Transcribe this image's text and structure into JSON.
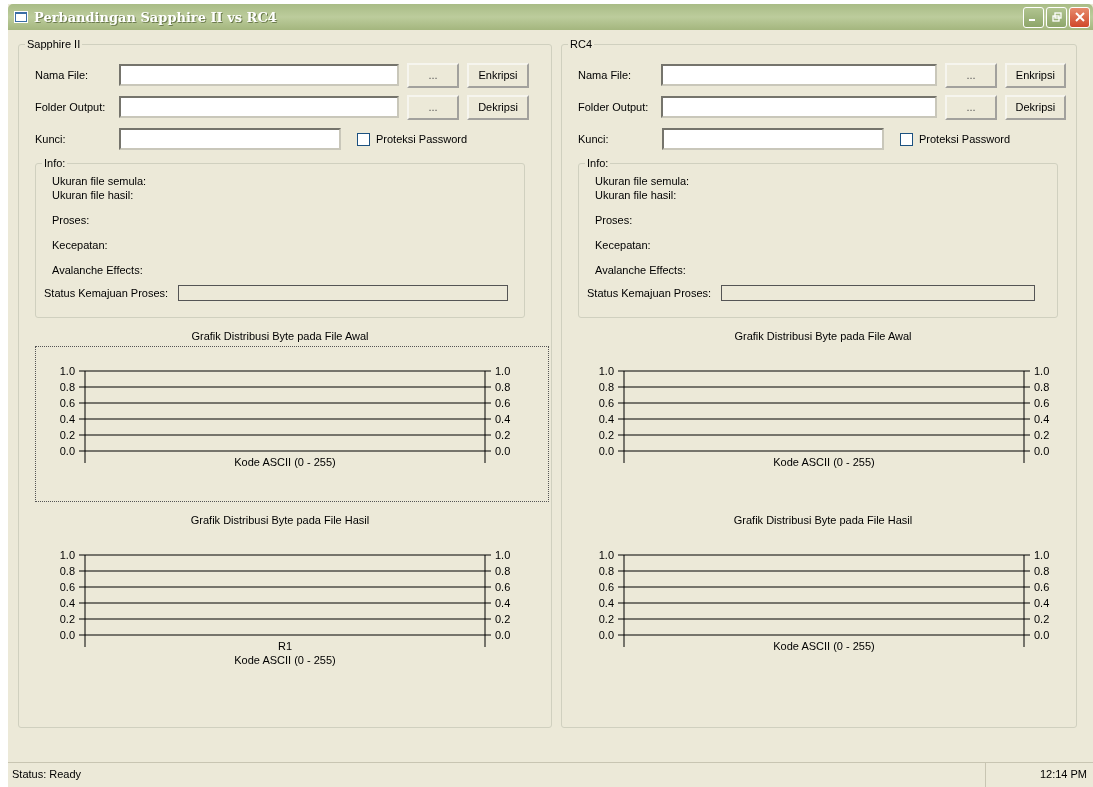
{
  "window": {
    "title": "Perbandingan Sapphire II vs RC4"
  },
  "panels": [
    {
      "title": "Sapphire II",
      "fields": [
        {
          "label": "Nama File:",
          "browse": "...",
          "action": "Enkripsi"
        },
        {
          "label": "Folder Output:",
          "browse": "...",
          "action": "Dekripsi"
        }
      ],
      "key": {
        "label": "Kunci:"
      },
      "password_protect": {
        "label": "Proteksi Password",
        "checked": false
      },
      "info": {
        "title": "Info:",
        "lines": [
          "Ukuran file semula:",
          "Ukuran file hasil:",
          "Proses:",
          "Kecepatan:",
          "Avalanche Effects:"
        ],
        "progress_label": "Status Kemajuan Proses:",
        "level": 0
      },
      "charts": [
        {
          "focused": true,
          "chart_data": {
            "type": "line",
            "grid": true,
            "title": "Grafik Distribusi Byte pada File Awal",
            "xlabel": "Kode ASCII (0 - 255)",
            "categories": [
              null
            ],
            "ylim": [
              0,
              1
            ],
            "yticks": [
              {
                "value": 0,
                "label": "0.0"
              },
              {
                "value": 0.2,
                "label": "0.2"
              },
              {
                "value": 0.4,
                "label": "0.4"
              },
              {
                "value": 0.6,
                "label": "0.6"
              },
              {
                "value": 0.8,
                "label": "0.8"
              },
              {
                "value": 1,
                "label": "1.0"
              }
            ]
          }
        },
        {
          "focused": false,
          "chart_data": {
            "type": "line",
            "grid": true,
            "title": "Grafik Distribusi Byte pada File Hasil",
            "xlabel": "Kode ASCII (0 - 255)",
            "categories": [
              "R1"
            ],
            "ylim": [
              0,
              1
            ],
            "yticks": [
              {
                "value": 0,
                "label": "0.0"
              },
              {
                "value": 0.2,
                "label": "0.2"
              },
              {
                "value": 0.4,
                "label": "0.4"
              },
              {
                "value": 0.6,
                "label": "0.6"
              },
              {
                "value": 0.8,
                "label": "0.8"
              },
              {
                "value": 1,
                "label": "1.0"
              }
            ]
          }
        }
      ]
    },
    {
      "title": "RC4",
      "fields": [
        {
          "label": "Nama File:",
          "browse": "...",
          "action": "Enkripsi"
        },
        {
          "label": "Folder Output:",
          "browse": "...",
          "action": "Dekripsi"
        }
      ],
      "key": {
        "label": "Kunci:"
      },
      "password_protect": {
        "label": "Proteksi Password",
        "checked": false
      },
      "info": {
        "title": "Info:",
        "lines": [
          "Ukuran file semula:",
          "Ukuran file hasil:",
          "Proses:",
          "Kecepatan:",
          "Avalanche Effects:"
        ],
        "progress_label": "Status Kemajuan Proses:",
        "level": 0
      },
      "charts": [
        {
          "focused": false,
          "chart_data": {
            "type": "line",
            "grid": true,
            "title": "Grafik Distribusi Byte pada File Awal",
            "xlabel": "Kode ASCII (0 - 255)",
            "categories": [
              null
            ],
            "ylim": [
              0,
              1
            ],
            "yticks": [
              {
                "value": 0,
                "label": "0.0"
              },
              {
                "value": 0.2,
                "label": "0.2"
              },
              {
                "value": 0.4,
                "label": "0.4"
              },
              {
                "value": 0.6,
                "label": "0.6"
              },
              {
                "value": 0.8,
                "label": "0.8"
              },
              {
                "value": 1,
                "label": "1.0"
              }
            ]
          }
        },
        {
          "focused": false,
          "chart_data": {
            "type": "line",
            "grid": true,
            "title": "Grafik Distribusi Byte pada File Hasil",
            "xlabel": "Kode ASCII (0 - 255)",
            "categories": [
              null
            ],
            "ylim": [
              0,
              1
            ],
            "yticks": [
              {
                "value": 0,
                "label": "0.0"
              },
              {
                "value": 0.2,
                "label": "0.2"
              },
              {
                "value": 0.4,
                "label": "0.4"
              },
              {
                "value": 0.6,
                "label": "0.6"
              },
              {
                "value": 0.8,
                "label": "0.8"
              },
              {
                "value": 1,
                "label": "1.0"
              }
            ]
          }
        }
      ]
    }
  ],
  "status_bar": {
    "status": "Status: Ready",
    "time": "12:14 PM"
  }
}
